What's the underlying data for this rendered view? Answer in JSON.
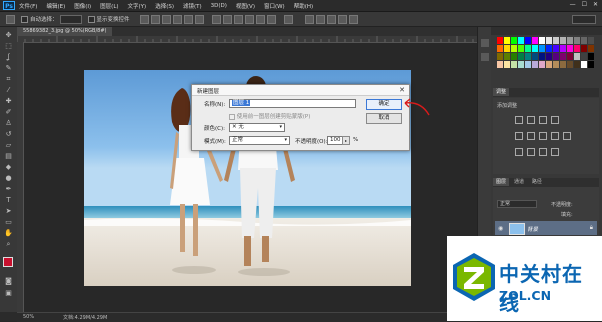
{
  "app": {
    "logo": "Ps"
  },
  "menubar": {
    "items": [
      "文件(F)",
      "编辑(E)",
      "图像(I)",
      "图层(L)",
      "文字(Y)",
      "选择(S)",
      "滤镜(T)",
      "3D(D)",
      "视图(V)",
      "窗口(W)",
      "帮助(H)"
    ],
    "window_buttons": [
      "—",
      "☐",
      "✕"
    ]
  },
  "optionsbar": {
    "auto_select_label": "自动选择：",
    "show_transform_label": "显示变换控件"
  },
  "document": {
    "tab_label": "55869382_3.jpg @ 50%(RGB/8#)",
    "zoom": "50%",
    "doc_info": "文档:4.29M/4.29M"
  },
  "dialog": {
    "title": "新建图层",
    "close": "✕",
    "name_label": "名称(N):",
    "name_value": "图层 1",
    "clip_label": "使用前一图层创建剪贴蒙版(P)",
    "color_label": "颜色(C):",
    "color_value": "✕ 无",
    "mode_label": "模式(M):",
    "mode_value": "正常",
    "opacity_label": "不透明度(O):",
    "opacity_value": "100",
    "opacity_unit": "%",
    "ok_label": "确定",
    "cancel_label": "取消"
  },
  "right_panel": {
    "adjust_title": "调整",
    "adjust_sub": "添加调整",
    "layers_tabs": [
      "图层",
      "通道",
      "路径"
    ],
    "blend_mode": "正常",
    "opacity_label": "不透明度:",
    "fill_label": "填充:",
    "layer_name": "背景"
  },
  "watermark": {
    "cn": "中关村在线",
    "en": "ZOL.CN",
    "en_suffix": ".CN",
    "en_prefix": "ZOL"
  },
  "colors": {
    "accent": "#3b78d6",
    "photoshop_blue": "#31a8ff",
    "zol_blue": "#0b66b2",
    "zol_green": "#7ab800"
  }
}
